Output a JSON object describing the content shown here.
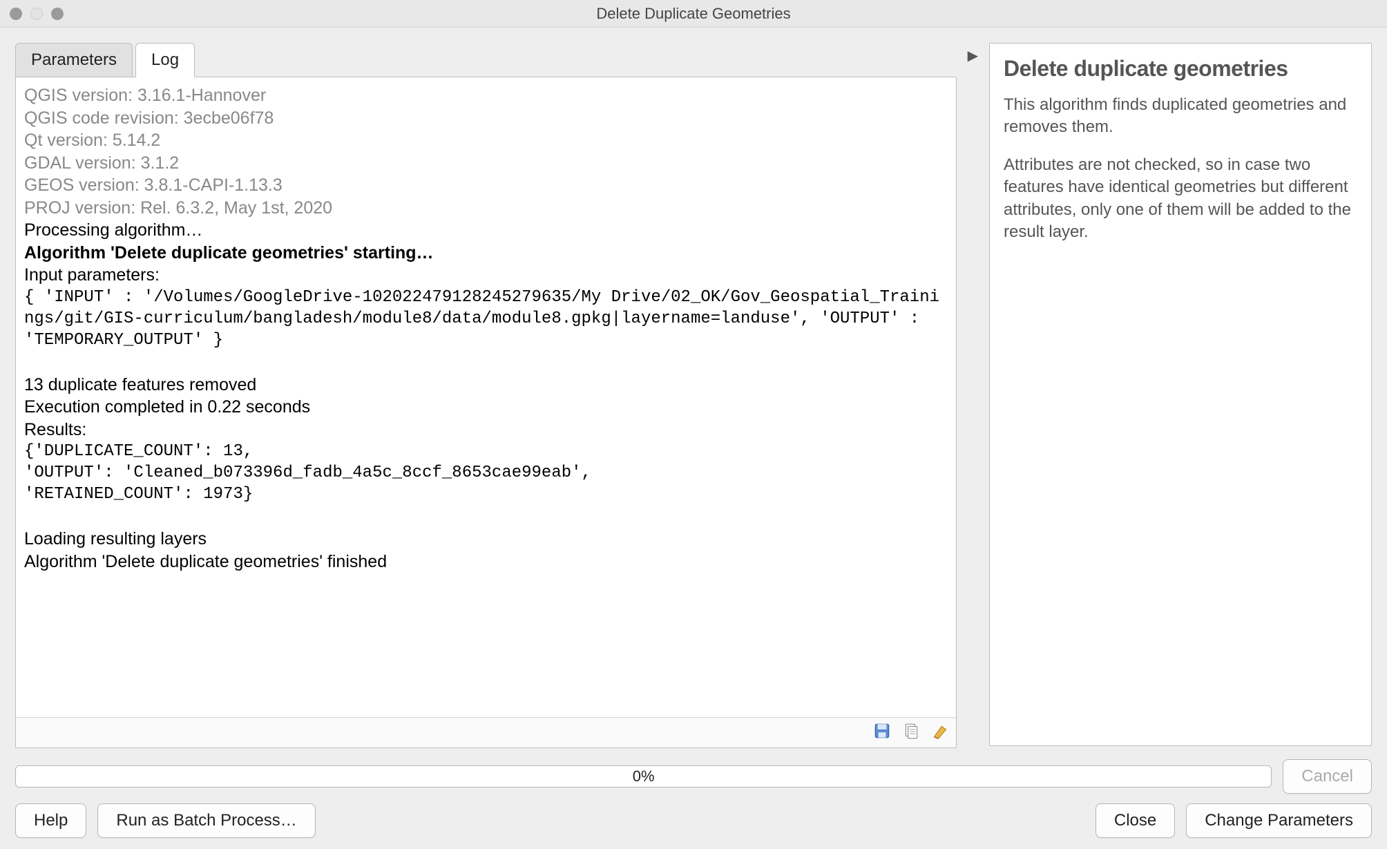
{
  "window": {
    "title": "Delete Duplicate Geometries"
  },
  "tabs": {
    "parameters": "Parameters",
    "log": "Log"
  },
  "log": {
    "qgis_version_label": "QGIS version: 3.16.1-Hannover",
    "qgis_code_rev_label": "QGIS code revision: 3ecbe06f78",
    "qt_version_label": "Qt version: 5.14.2",
    "gdal_version_label": "GDAL version: 3.1.2",
    "geos_version_label": "GEOS version: 3.8.1-CAPI-1.13.3",
    "proj_version_label": "PROJ version: Rel. 6.3.2, May 1st, 2020",
    "processing_line": "Processing algorithm…",
    "starting_line": "Algorithm 'Delete duplicate geometries' starting…",
    "input_params_label": "Input parameters:",
    "input_params_value": "{ 'INPUT' : '/Volumes/GoogleDrive-102022479128245279635/My Drive/02_OK/Gov_Geospatial_Trainings/git/GIS-curriculum/bangladesh/module8/data/module8.gpkg|layername=landuse', 'OUTPUT' : 'TEMPORARY_OUTPUT' }",
    "duplicates_removed": "13 duplicate features removed",
    "execution_time": "Execution completed in 0.22 seconds",
    "results_label": "Results:",
    "results_value_1": "{'DUPLICATE_COUNT': 13,",
    "results_value_2": "'OUTPUT': 'Cleaned_b073396d_fadb_4a5c_8ccf_8653cae99eab',",
    "results_value_3": "'RETAINED_COUNT': 1973}",
    "loading_line": "Loading resulting layers",
    "finished_line": "Algorithm 'Delete duplicate geometries' finished"
  },
  "help": {
    "title": "Delete duplicate geometries",
    "p1": "This algorithm finds duplicated geometries and removes them.",
    "p2": "Attributes are not checked, so in case two features have identical geometries but different attributes, only one of them will be added to the result layer."
  },
  "progress": {
    "text": "0%"
  },
  "buttons": {
    "cancel": "Cancel",
    "help": "Help",
    "run_batch": "Run as Batch Process…",
    "close": "Close",
    "change_params": "Change Parameters"
  }
}
